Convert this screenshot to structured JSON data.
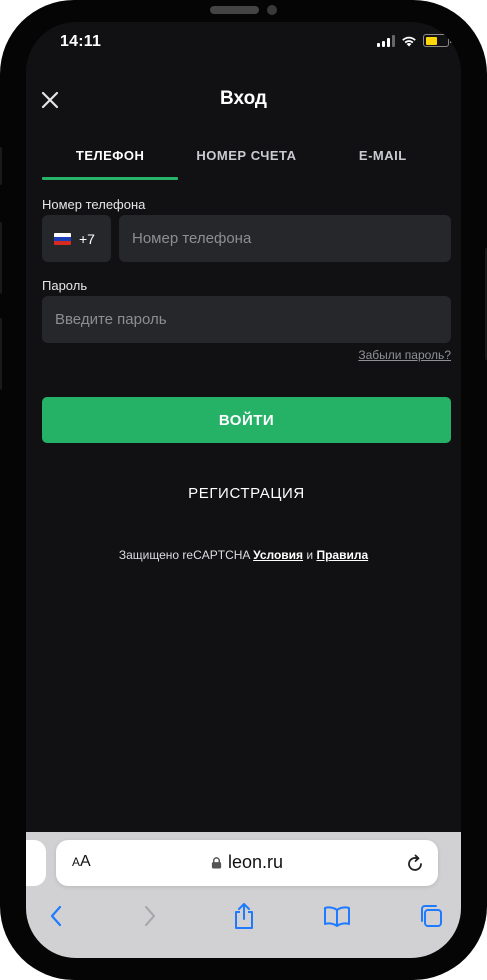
{
  "status_bar": {
    "time": "14:11"
  },
  "header": {
    "title": "Вход"
  },
  "tabs": [
    {
      "label": "ТЕЛЕФОН",
      "active": true
    },
    {
      "label": "НОМЕР СЧЕТА",
      "active": false
    },
    {
      "label": "E-MAIL",
      "active": false
    }
  ],
  "form": {
    "phone_label": "Номер телефона",
    "country_code": "+7",
    "phone_placeholder": "Номер телефона",
    "password_label": "Пароль",
    "password_placeholder": "Введите пароль",
    "forgot_password": "Забыли пароль?",
    "login_button": "ВОЙТИ",
    "register_button": "РЕГИСТРАЦИЯ"
  },
  "recaptcha": {
    "prefix": "Защищено reCAPTCHA",
    "terms": "Условия",
    "conjunction": "и",
    "rules": "Правила"
  },
  "browser": {
    "text_size_label": "AA",
    "url": "leon.ru"
  },
  "colors": {
    "accent_green": "#25b267",
    "background": "#111113",
    "input_bg": "#26272b",
    "battery_yellow": "#ffd60a"
  },
  "icons": {
    "close": "close-icon",
    "flag": "russia-flag-icon",
    "lock": "lock-icon",
    "reload": "reload-icon",
    "back": "chevron-left-icon",
    "forward": "chevron-right-icon",
    "share": "share-icon",
    "bookmarks": "book-icon",
    "tabs": "tabs-icon"
  }
}
